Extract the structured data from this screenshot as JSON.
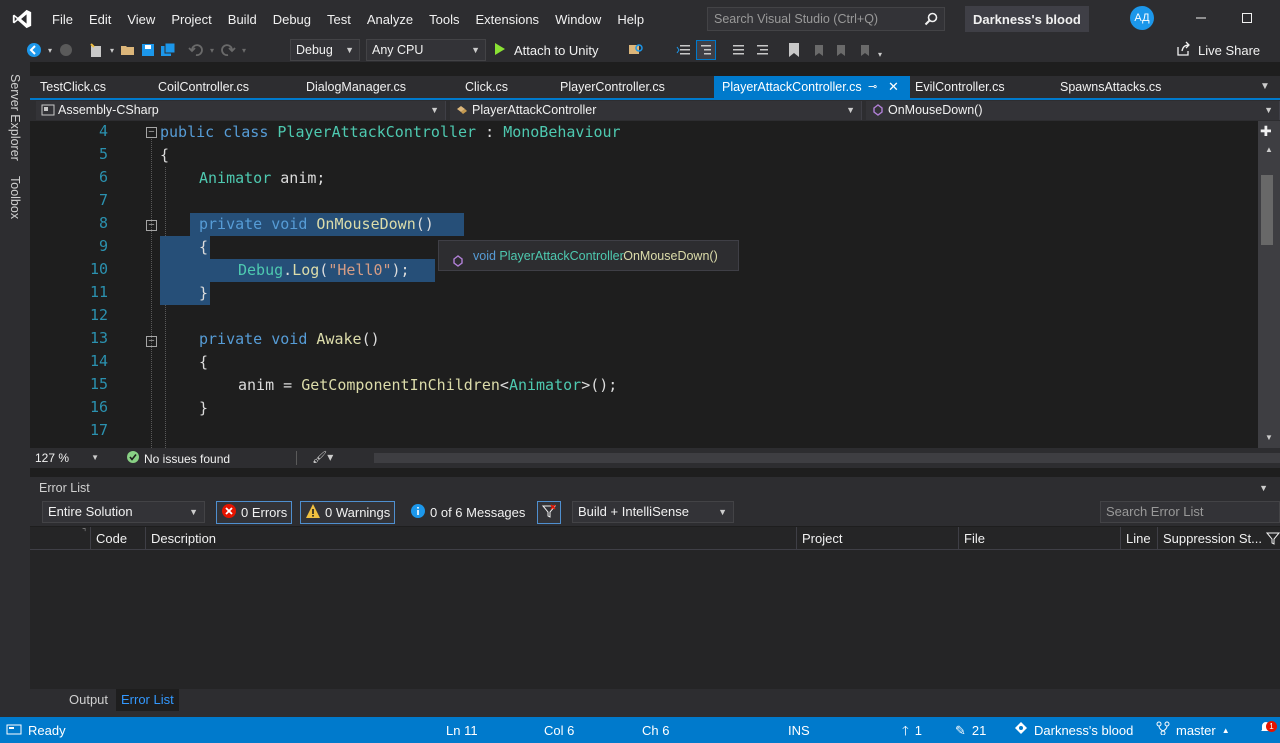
{
  "menu": [
    "File",
    "Edit",
    "View",
    "Project",
    "Build",
    "Debug",
    "Test",
    "Analyze",
    "Tools",
    "Extensions",
    "Window",
    "Help"
  ],
  "search_placeholder": "Search Visual Studio (Ctrl+Q)",
  "solution_name": "Darkness's blood",
  "user_initials": "АД",
  "toolbar": {
    "config": "Debug",
    "platform": "Any CPU",
    "attach_label": "Attach to Unity",
    "live_share": "Live Share"
  },
  "side_tabs": [
    "Server Explorer",
    "Toolbox"
  ],
  "doc_tabs": [
    {
      "label": "TestClick.cs",
      "active": false
    },
    {
      "label": "CoilController.cs",
      "active": false
    },
    {
      "label": "DialogManager.cs",
      "active": false
    },
    {
      "label": "Click.cs",
      "active": false
    },
    {
      "label": "PlayerController.cs",
      "active": false
    },
    {
      "label": "PlayerAttackController.cs",
      "active": true
    },
    {
      "label": "EvilController.cs",
      "active": false
    },
    {
      "label": "SpawnsAttacks.cs",
      "active": false
    }
  ],
  "nav": {
    "project": "Assembly-CSharp",
    "class": "PlayerAttackController",
    "member": "OnMouseDown()"
  },
  "line_numbers": [
    "4",
    "5",
    "6",
    "7",
    "8",
    "9",
    "10",
    "11",
    "12",
    "13",
    "14",
    "15",
    "16",
    "17"
  ],
  "code": {
    "l4": {
      "kw": "public class",
      "name": "PlayerAttackController",
      "sep": " : ",
      "base": "MonoBehaviour"
    },
    "l5": "{",
    "l6": {
      "type": "Animator",
      "rest": " anim;"
    },
    "l8": {
      "kw": "private void",
      "name": "OnMouseDown",
      "rest": "()"
    },
    "l9": "{",
    "l10": {
      "cls": "Debug",
      "dot": ".",
      "fn": "Log",
      "open": "(",
      "str": "\"Hell0\"",
      "close": ");"
    },
    "l11": "}",
    "l13": {
      "kw": "private void",
      "name": "Awake",
      "rest": "()"
    },
    "l14": "{",
    "l15": {
      "pre": "anim = ",
      "fn": "GetComponentInChildren",
      "lt": "<",
      "type": "Animator",
      "rest": ">();"
    },
    "l16": "}"
  },
  "tooltip": {
    "kw": "void",
    "cls": "PlayerAttackController",
    "rest": ".OnMouseDown()"
  },
  "editor_status": {
    "zoom": "127 %",
    "issues": "No issues found"
  },
  "error_list": {
    "title": "Error List",
    "scope": "Entire Solution",
    "errors": "0 Errors",
    "warnings": "0 Warnings",
    "messages": "0 of 6 Messages",
    "source": "Build + IntelliSense",
    "search_placeholder": "Search Error List",
    "columns": [
      "Code",
      "Description",
      "Project",
      "File",
      "Line",
      "Suppression St..."
    ]
  },
  "bottom_tabs": [
    {
      "label": "Output",
      "active": false
    },
    {
      "label": "Error List",
      "active": true
    }
  ],
  "statusbar": {
    "ready": "Ready",
    "ln": "Ln 11",
    "col": "Col 6",
    "ch": "Ch 6",
    "ins": "INS",
    "up": "1",
    "edits": "21",
    "repo": "Darkness's blood",
    "branch": "master",
    "notifications": "1"
  },
  "colors": {
    "accent": "#007acc",
    "keyword": "#569cd6",
    "type": "#4ec9b0",
    "method": "#dcdcaa",
    "string": "#d69d85",
    "line_number": "#2b91af"
  }
}
